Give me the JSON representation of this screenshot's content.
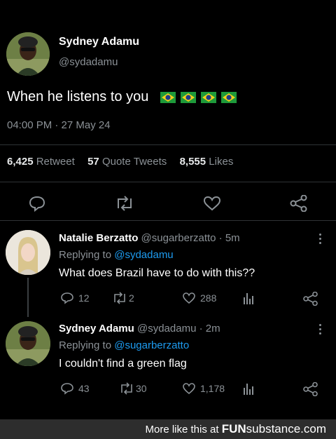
{
  "main_tweet": {
    "author_name": "Sydney Adamu",
    "author_handle": "@sydadamu",
    "text": "When he listens to you",
    "flags": [
      "brazil-flag",
      "brazil-flag",
      "brazil-flag",
      "brazil-flag"
    ],
    "timestamp": "04:00 PM · 27 May 24",
    "stats": {
      "retweets_count": "6,425",
      "retweets_label": "Retweet",
      "quotes_count": "57",
      "quotes_label": "Quote Tweets",
      "likes_count": "8,555",
      "likes_label": "Likes"
    },
    "actions": [
      "reply-icon",
      "retweet-icon",
      "like-icon",
      "share-icon"
    ]
  },
  "replies": [
    {
      "author_name": "Natalie Berzatto",
      "author_handle": "@sugarberzatto",
      "time": "· 5m",
      "replying_prefix": "Replying to",
      "replying_to": "@sydadamu",
      "text": "What does Brazil have to do with this??",
      "reply_count": "12",
      "retweet_count": "2",
      "like_count": "288"
    },
    {
      "author_name": "Sydney Adamu",
      "author_handle": "@sydadamu",
      "time": "· 2m",
      "replying_prefix": "Replying to",
      "replying_to": "@sugarberzatto",
      "text": "I couldn't find a green flag",
      "reply_count": "43",
      "retweet_count": "30",
      "like_count": "1,178"
    }
  ],
  "footer": {
    "text": "More like this at",
    "brand_bold": "FUN",
    "brand_rest": "substance.com"
  },
  "colors": {
    "background": "#000000",
    "text": "#e7e9ea",
    "muted": "#8b9196",
    "link": "#1d9bf0",
    "flag_green": "#1e9a3a",
    "flag_yellow": "#f2d21b",
    "flag_blue": "#1c3b8a"
  }
}
